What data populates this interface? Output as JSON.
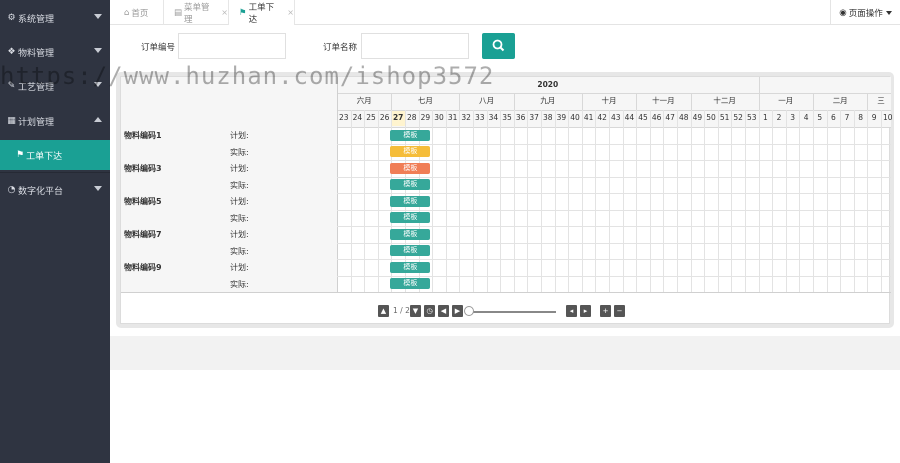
{
  "sidebar": {
    "items": [
      {
        "label": "系统管理",
        "icon": "gears-icon"
      },
      {
        "label": "物料管理",
        "icon": "cubes-icon"
      },
      {
        "label": "工艺管理",
        "icon": "wrench-icon"
      },
      {
        "label": "计划管理",
        "icon": "calendar-icon"
      },
      {
        "label": "数字化平台",
        "icon": "pie-chart-icon"
      }
    ],
    "sub_item": {
      "label": "工单下达",
      "icon": "flag-icon"
    }
  },
  "tabs": [
    {
      "label": "首页",
      "icon": "home-icon"
    },
    {
      "label": "菜单管理",
      "icon": "menu-icon"
    },
    {
      "label": "工单下达",
      "icon": "flag-icon"
    }
  ],
  "tab_close": "×",
  "page_ops": {
    "label": "页面操作",
    "icon": "circle-dot-icon"
  },
  "search_form": {
    "order_no_label": "订单编号",
    "order_name_label": "订单名称",
    "order_no_value": "",
    "order_name_value": "",
    "search_icon": "search-icon"
  },
  "gantt": {
    "year": "2020",
    "months": [
      "六月",
      "七月",
      "八月",
      "九月",
      "十月",
      "十一月",
      "十二月",
      "一月",
      "二月",
      "三"
    ],
    "weeks": [
      "23",
      "24",
      "25",
      "26",
      "27",
      "28",
      "29",
      "30",
      "31",
      "32",
      "33",
      "34",
      "35",
      "36",
      "37",
      "38",
      "39",
      "40",
      "41",
      "42",
      "43",
      "44",
      "45",
      "46",
      "47",
      "48",
      "49",
      "50",
      "51",
      "52",
      "53",
      "1",
      "2",
      "3",
      "4",
      "5",
      "6",
      "7",
      "8",
      "9",
      "10"
    ],
    "current_week": "27",
    "rows": [
      {
        "name": "物料编码1",
        "type": "计划:",
        "bar": "模板",
        "color": "#36a89a"
      },
      {
        "name": "",
        "type": "实际:",
        "bar": "模板",
        "color": "#f5bd3a"
      },
      {
        "name": "物料编码3",
        "type": "计划:",
        "bar": "模板",
        "color": "#f07e56"
      },
      {
        "name": "",
        "type": "实际:",
        "bar": "模板",
        "color": "#36a89a"
      },
      {
        "name": "物料编码5",
        "type": "计划:",
        "bar": "模板",
        "color": "#36a89a"
      },
      {
        "name": "",
        "type": "实际:",
        "bar": "模板",
        "color": "#36a89a"
      },
      {
        "name": "物料编码7",
        "type": "计划:",
        "bar": "模板",
        "color": "#36a89a"
      },
      {
        "name": "",
        "type": "实际:",
        "bar": "模板",
        "color": "#36a89a"
      },
      {
        "name": "物料编码9",
        "type": "计划:",
        "bar": "模板",
        "color": "#36a89a"
      },
      {
        "name": "",
        "type": "实际:",
        "bar": "模板",
        "color": "#36a89a"
      }
    ],
    "pager": {
      "page_text": "1 / 2"
    }
  },
  "watermark": "https://www.huzhan.com/ishop3572"
}
